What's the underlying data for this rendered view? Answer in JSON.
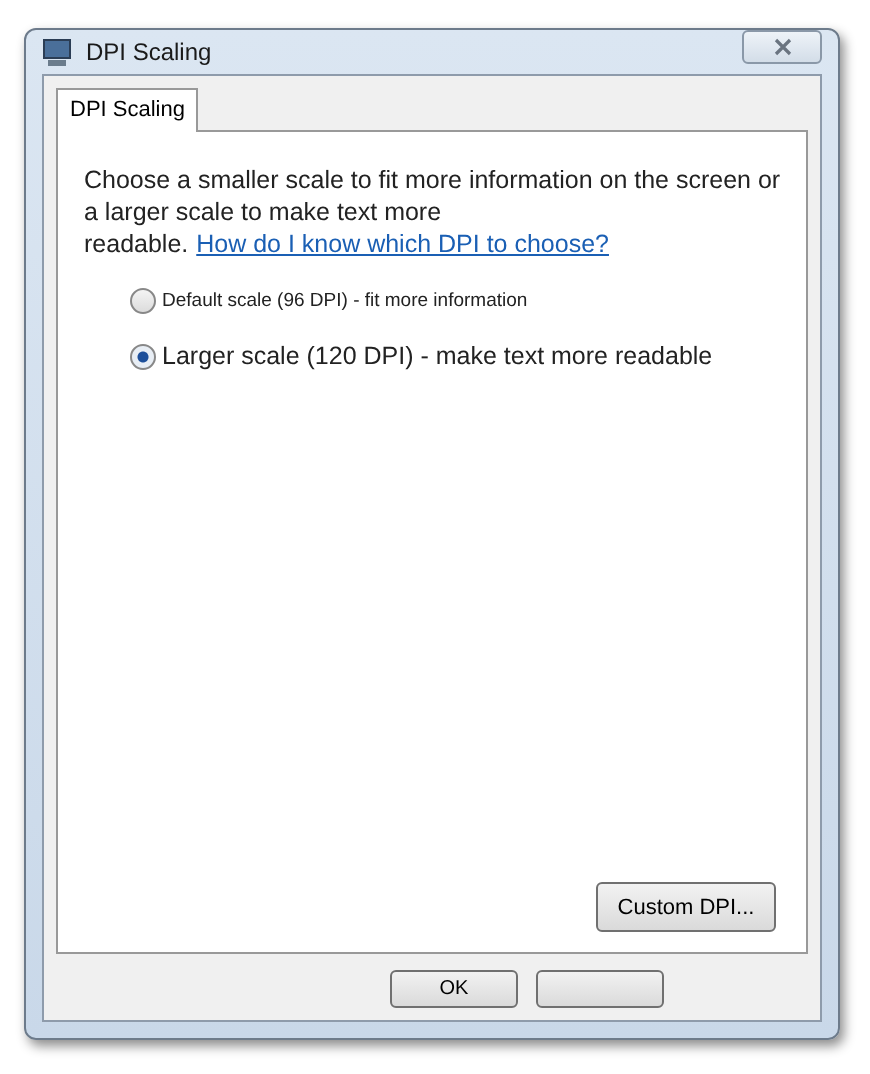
{
  "window": {
    "title": "DPI Scaling"
  },
  "tabs": [
    {
      "label": "DPI Scaling",
      "selected": true
    }
  ],
  "description": "Choose a smaller scale to fit more information on the screen or a larger scale to make text more readable.",
  "help_link": "How do I know which DPI to choose?",
  "options": [
    {
      "label": "Default scale (96 DPI) - fit more information",
      "selected": false,
      "kind": "small"
    },
    {
      "label": "Larger scale (120 DPI) - make text more readable",
      "selected": true,
      "kind": "large"
    }
  ],
  "custom_button": "Custom DPI...",
  "buttons": [
    {
      "kind": "labeled",
      "label": "OK"
    },
    {
      "kind": "blank"
    }
  ]
}
